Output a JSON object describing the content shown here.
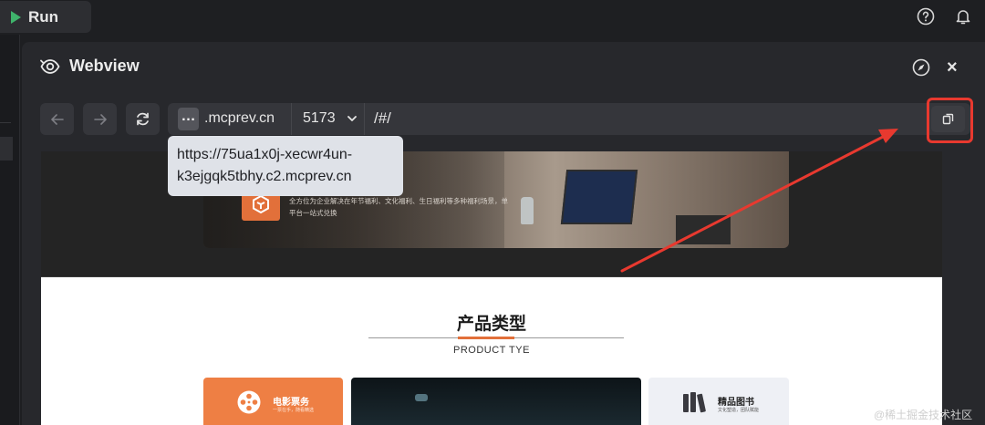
{
  "topbar": {
    "run_label": "Run",
    "help_icon": "help-circle-icon",
    "bell_icon": "bell-icon"
  },
  "panel": {
    "title": "Webview",
    "title_icon": "eye-icon",
    "compass_icon": "compass-icon",
    "close_label": "×"
  },
  "nav": {
    "back_icon": "arrow-left-icon",
    "forward_icon": "arrow-right-icon",
    "reload_icon": "reload-icon"
  },
  "urlbar": {
    "ellipsis": "…",
    "domain": ".mcprev.cn",
    "port": "5173",
    "path": "/#/",
    "copy_icon": "copy-icon"
  },
  "tooltip": {
    "url_line1": "https://75ua1x0j-xecwr4un-",
    "url_line2": "k3ejgqk5tbhy.c2.mcprev.cn"
  },
  "webview": {
    "hero_text": "全方位为企业解决在年节福利、文化福利、生日福利等多种福利场景，单平台一站式兑换",
    "section_title": "产品类型",
    "section_sub": "PRODUCT TYE",
    "cards": [
      {
        "title": "电影票务",
        "sub": "一票在手，随看精选"
      },
      {
        "title": "精品图书",
        "sub": "文化塑造，团队赋能"
      }
    ]
  },
  "colors": {
    "accent_orange": "#ee7f44",
    "highlight_red": "#e8392f",
    "run_green": "#3fb36b"
  },
  "watermark": "@稀土掘金技术社区"
}
